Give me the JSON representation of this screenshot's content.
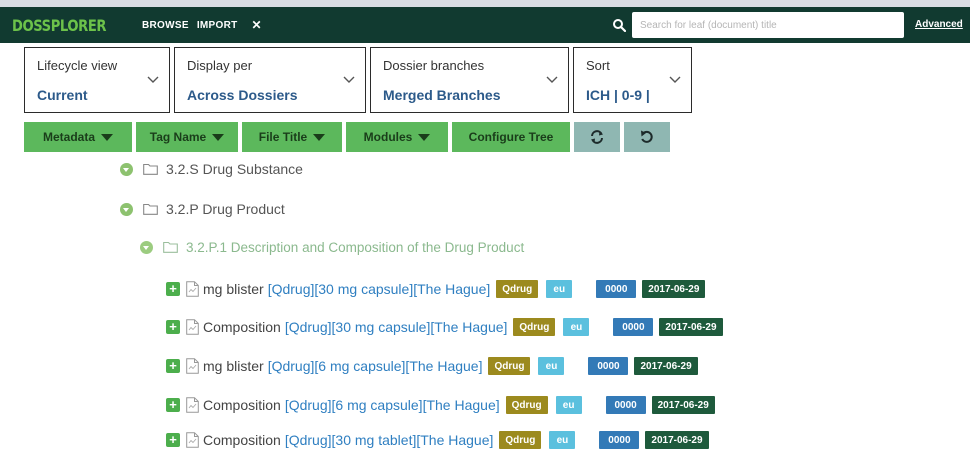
{
  "nav": {
    "brand": "DOSSPLORER",
    "links": [
      "BROWSE",
      "IMPORT"
    ],
    "close_symbol": "✕",
    "search_placeholder": "Search for leaf (document) title",
    "advanced_label": "Advanced"
  },
  "selectors": [
    {
      "label": "Lifecycle view",
      "value": "Current"
    },
    {
      "label": "Display per",
      "value": "Across Dossiers"
    },
    {
      "label": "Dossier branches",
      "value": "Merged Branches"
    },
    {
      "label": "Sort",
      "value": "ICH | 0-9 |"
    }
  ],
  "toolbar": {
    "buttons": [
      "Metadata",
      "Tag Name",
      "File Title",
      "Modules",
      "Configure Tree"
    ],
    "icons": [
      "refresh-icon",
      "undo-icon"
    ]
  },
  "tree": {
    "nodes": [
      {
        "label": "3.2.S Drug Substance"
      },
      {
        "label": "3.2.P Drug Product"
      },
      {
        "label": "3.2.P.1 Description and Composition of the Drug Product"
      }
    ],
    "leaves": [
      {
        "name": "mg blister",
        "meta": "[Qdrug][30 mg capsule][The Hague]",
        "tag": "Qdrug",
        "region": "eu",
        "seq": "0000",
        "date": "2017-06-29"
      },
      {
        "name": "Composition",
        "meta": "[Qdrug][30 mg capsule][The Hague]",
        "tag": "Qdrug",
        "region": "eu",
        "seq": "0000",
        "date": "2017-06-29"
      },
      {
        "name": "mg blister",
        "meta": "[Qdrug][6 mg capsule][The Hague]",
        "tag": "Qdrug",
        "region": "eu",
        "seq": "0000",
        "date": "2017-06-29"
      },
      {
        "name": "Composition",
        "meta": "[Qdrug][6 mg capsule][The Hague]",
        "tag": "Qdrug",
        "region": "eu",
        "seq": "0000",
        "date": "2017-06-29"
      },
      {
        "name": "Composition",
        "meta": "[Qdrug][30 mg tablet][The Hague]",
        "tag": "Qdrug",
        "region": "eu",
        "seq": "0000",
        "date": "2017-06-29"
      }
    ]
  },
  "colors": {
    "navbar": "#113a30",
    "brand": "#6cc24a",
    "toolbar_button": "#5cb85c",
    "icon_button": "#8fb7b2",
    "tag_qdrug": "#9c8a1e",
    "tag_region": "#5bc0de",
    "tag_sequence": "#337ab7",
    "tag_date": "#1e5a3c"
  }
}
